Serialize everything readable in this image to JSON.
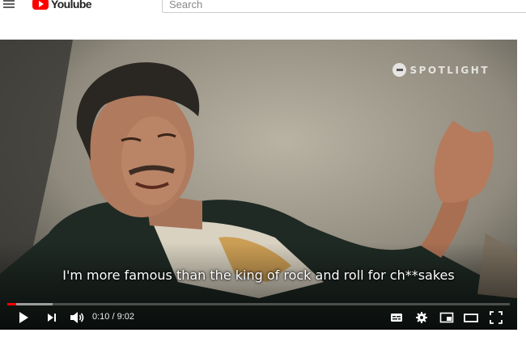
{
  "masthead": {
    "logo_text": "Youlube",
    "search_placeholder": "Search"
  },
  "video": {
    "watermark": "SPOTLIGHT",
    "caption": "I'm more famous than the king of rock and roll for ch**sakes",
    "current_time": "0:10",
    "duration": "9:02",
    "time_display": "0:10 / 9:02",
    "progress_played_fraction": 0.018,
    "progress_loaded_fraction": 0.09
  },
  "colors": {
    "brand_red": "#ff0000",
    "progress_red": "#ff0000",
    "player_bg": "#1a1c1f"
  },
  "icons": {
    "menu": "hamburger-icon",
    "play": "play-icon",
    "next": "next-icon",
    "volume": "volume-icon",
    "subtitles": "subtitles-icon",
    "settings": "gear-icon",
    "miniplayer": "miniplayer-icon",
    "theater": "theater-mode-icon",
    "fullscreen": "fullscreen-icon"
  }
}
